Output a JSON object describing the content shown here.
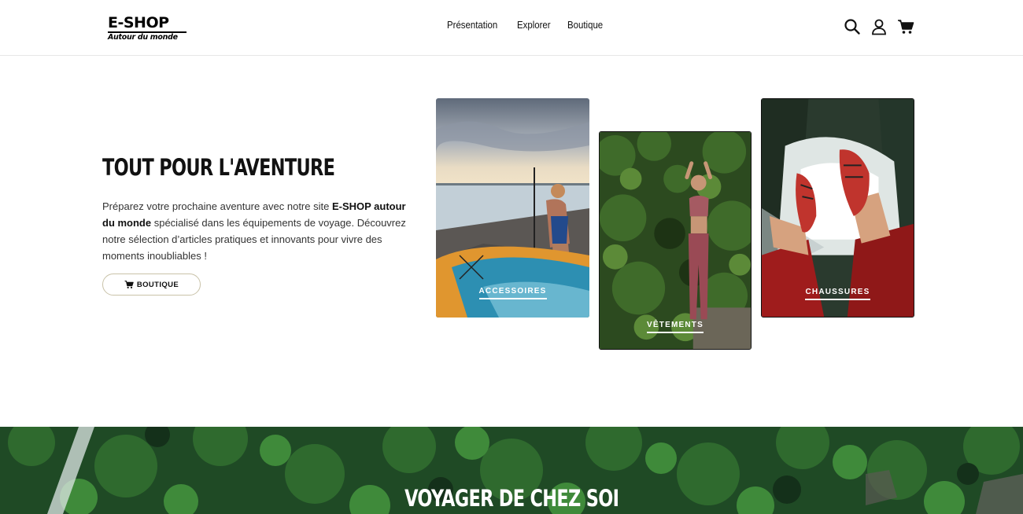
{
  "header": {
    "logo_main": "E-SHOP",
    "logo_sub": "Autour du monde",
    "nav": [
      "Présentation",
      "Explorer",
      "Boutique"
    ],
    "icons": [
      "search-icon",
      "account-icon",
      "cart-icon"
    ]
  },
  "hero": {
    "title": "TOUT POUR L'AVENTURE",
    "text_1": "Préparez votre prochaine aventure avec notre site ",
    "text_bold": "E-SHOP autour du monde",
    "text_2": " spécialisé dans les équipements de voyage. Découvrez notre sélection d’articles pratiques et innovants pour vivre des moments inoubliables !",
    "button_label": "BOUTIQUE"
  },
  "categories": [
    {
      "label": "ACCESSOIRES"
    },
    {
      "label": "VÊTEMENTS"
    },
    {
      "label": "CHAUSSURES"
    }
  ],
  "banner": {
    "title": "VOYAGER DE CHEZ SOI"
  },
  "colors": {
    "accent_border": "#c9c2a8",
    "text": "#222222",
    "forest": "#1f4a25"
  }
}
